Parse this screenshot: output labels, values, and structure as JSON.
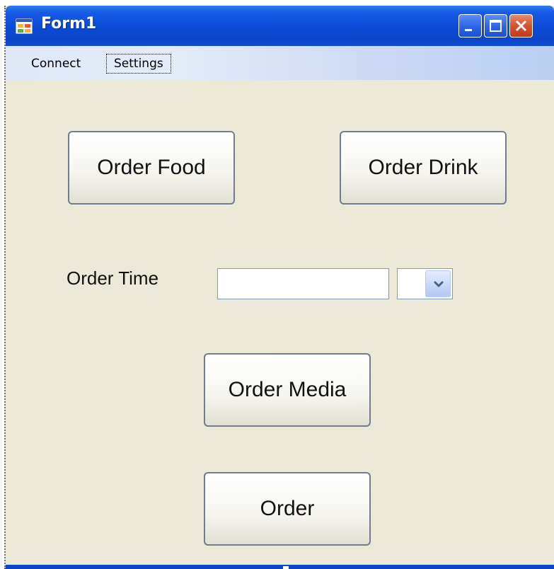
{
  "window": {
    "title": "Form1"
  },
  "menu": {
    "items": [
      {
        "label": "Connect"
      },
      {
        "label": "Settings"
      }
    ]
  },
  "buttons": {
    "order_food": "Order Food",
    "order_drink": "Order Drink",
    "order_media": "Order Media",
    "order": "Order"
  },
  "order_time": {
    "label": "Order Time",
    "value": "",
    "combo_value": ""
  },
  "icons": {
    "app": "form-app-icon",
    "minimize": "minimize-icon",
    "maximize": "maximize-icon",
    "close": "close-icon",
    "dropdown": "chevron-down-icon"
  },
  "colors": {
    "titlebar": "#0a4bd6",
    "window_bg": "#ece9d8",
    "close_button": "#d6532c"
  }
}
